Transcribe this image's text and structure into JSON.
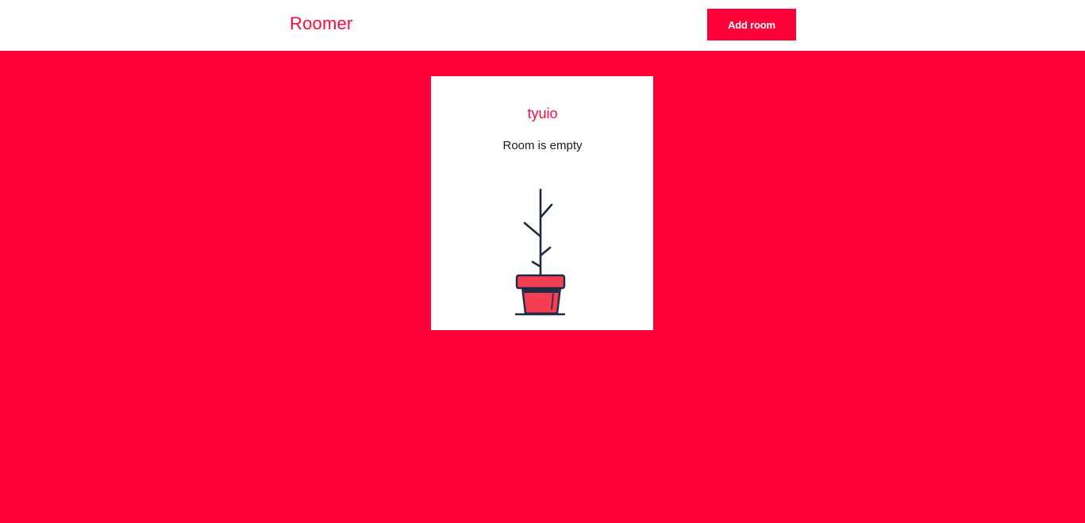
{
  "header": {
    "brand": "Roomer",
    "add_room_label": "Add room"
  },
  "room": {
    "name": "tyuio",
    "status": "Room is empty",
    "illustration_icon": "potted-plant-icon"
  },
  "colors": {
    "accent": "#ff0039",
    "brand_text": "#ff0a3c",
    "card_bg": "#ffffff",
    "plant_stroke": "#1f2a44",
    "pot_fill": "#f43f52"
  }
}
